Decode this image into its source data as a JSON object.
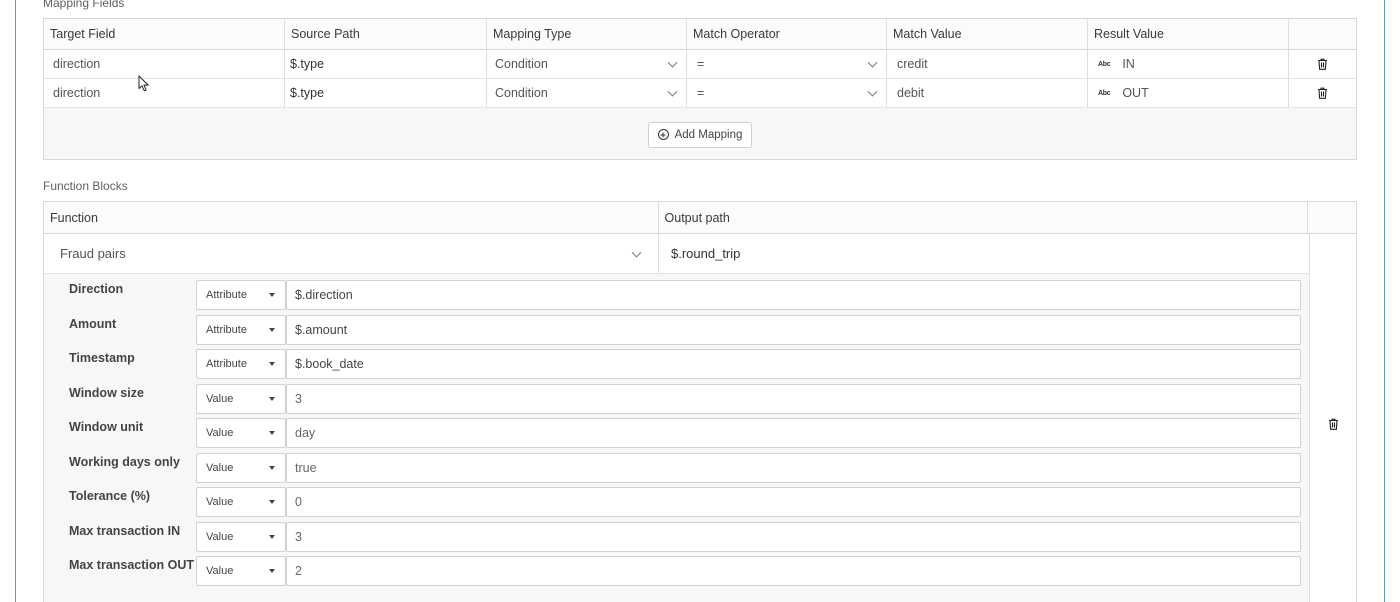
{
  "mapping": {
    "section_title": "Mapping Fields",
    "columns": [
      "Target Field",
      "Source Path",
      "Mapping Type",
      "Match Operator",
      "Match Value",
      "Result Value",
      ""
    ],
    "rows": [
      {
        "target": "direction",
        "source": "$.type",
        "mapping_type": "Condition",
        "operator": "=",
        "match_value": "credit",
        "result_type_icon": "Abc",
        "result_value": "IN"
      },
      {
        "target": "direction",
        "source": "$.type",
        "mapping_type": "Condition",
        "operator": "=",
        "match_value": "debit",
        "result_type_icon": "Abc",
        "result_value": "OUT"
      }
    ],
    "add_label": "Add Mapping"
  },
  "functions": {
    "section_title": "Function Blocks",
    "columns": [
      "Function",
      "Output path",
      ""
    ],
    "block": {
      "function": "Fraud pairs",
      "output_path": "$.round_trip",
      "params": [
        {
          "label": "Direction",
          "type": "Attribute",
          "value": "$.direction"
        },
        {
          "label": "Amount",
          "type": "Attribute",
          "value": "$.amount"
        },
        {
          "label": "Timestamp",
          "type": "Attribute",
          "value": "$.book_date"
        },
        {
          "label": "Window size",
          "type": "Value",
          "value": "3"
        },
        {
          "label": "Window unit",
          "type": "Value",
          "value": "day"
        },
        {
          "label": "Working days only",
          "type": "Value",
          "value": "true"
        },
        {
          "label": "Tolerance (%)",
          "type": "Value",
          "value": "0"
        },
        {
          "label": "Max transaction IN",
          "type": "Value",
          "value": "3"
        },
        {
          "label": "Max transaction OUT",
          "type": "Value",
          "value": "2"
        }
      ]
    }
  },
  "icons": {
    "delete": "trash-icon",
    "add": "plus-circle-icon",
    "dropdown": "chevron-down-icon",
    "type_caret": "caret-down-icon",
    "text_type": "abc-icon",
    "cursor": "mouse-pointer-icon"
  }
}
